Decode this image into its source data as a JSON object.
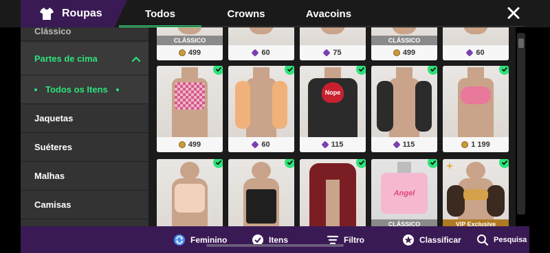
{
  "header": {
    "title": "Roupas",
    "tabs": [
      {
        "label": "Todos",
        "active": true
      },
      {
        "label": "Crowns",
        "active": false
      },
      {
        "label": "Avacoins",
        "active": false
      }
    ]
  },
  "sidebar": {
    "items": [
      {
        "label": "Clássico"
      },
      {
        "label": "Partes de cima"
      },
      {
        "label": "Todos os Itens"
      },
      {
        "label": "Jaquetas"
      },
      {
        "label": "Suéteres"
      },
      {
        "label": "Malhas"
      },
      {
        "label": "Camisas"
      }
    ]
  },
  "grid": {
    "row0": [
      {
        "price": "499",
        "currency": "gold-coin",
        "badge": "CLÁSSICO"
      },
      {
        "price": "60",
        "currency": "gem",
        "badge": ""
      },
      {
        "price": "75",
        "currency": "gem",
        "badge": ""
      },
      {
        "price": "499",
        "currency": "gold-coin",
        "badge": "CLÁSSICO"
      },
      {
        "price": "60",
        "currency": "gem",
        "badge": ""
      }
    ],
    "row1": [
      {
        "price": "499",
        "currency": "gold-coin",
        "outfit": "pink checkered halter top",
        "color": "#d45a8a"
      },
      {
        "price": "60",
        "currency": "gem",
        "outfit": "peach ruffled shrug",
        "color": "#f0b27a"
      },
      {
        "price": "115",
        "currency": "gem",
        "outfit": "black jacket with heart",
        "color": "#2b2b2b",
        "heart_text": "Nope"
      },
      {
        "price": "115",
        "currency": "gem",
        "outfit": "black puffer shrug",
        "color": "#2b2b2b"
      },
      {
        "price": "1 199",
        "currency": "gold-coin",
        "outfit": "pink lace bra top",
        "color": "#e8799a"
      }
    ],
    "row2": [
      {
        "outfit": "beige halter crop top",
        "color": "#f3d2bd",
        "badge": ""
      },
      {
        "outfit": "black lace-up corset",
        "color": "#1f1f1f",
        "badge": ""
      },
      {
        "outfit": "red plaid hoodie",
        "color": "#7a1e24",
        "badge": ""
      },
      {
        "outfit": "pink Angel t-shirt",
        "color": "#f6b8d0",
        "badge": "CLÁSSICO",
        "shirt_text": "Angel"
      },
      {
        "outfit": "gold bikini with puffed sleeves",
        "color": "#3a2a20",
        "badge": "VIP Exclusive"
      }
    ]
  },
  "bottombar": {
    "feminino": "Feminino",
    "itens": "Itens",
    "filtro": "Filtro",
    "classificar": "Classificar",
    "pesquisa": "Pesquisa"
  },
  "colors": {
    "accent": "#2ee27a",
    "brand_purple": "#3a1a55",
    "sidebar": "#333333"
  }
}
